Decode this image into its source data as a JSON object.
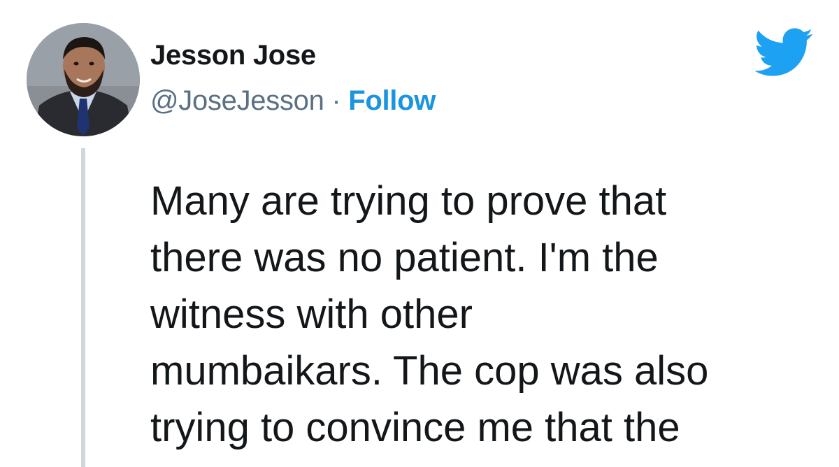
{
  "author": {
    "display_name": "Jesson Jose",
    "handle": "@JoseJesson",
    "separator": "·",
    "follow_label": "Follow",
    "avatar": "profile-photo"
  },
  "brand": {
    "logo": "twitter-bird-icon",
    "color": "#1da1f2"
  },
  "tweet": {
    "lines": [
      "Many are trying to prove that",
      "there was no patient. I'm the",
      "witness with other",
      "mumbaikars. The cop was also",
      "trying to convince me that the"
    ]
  },
  "colors": {
    "text": "#14171a",
    "secondary": "#5b7083",
    "link": "#1b95e0",
    "thread_line": "#d0d6db"
  }
}
